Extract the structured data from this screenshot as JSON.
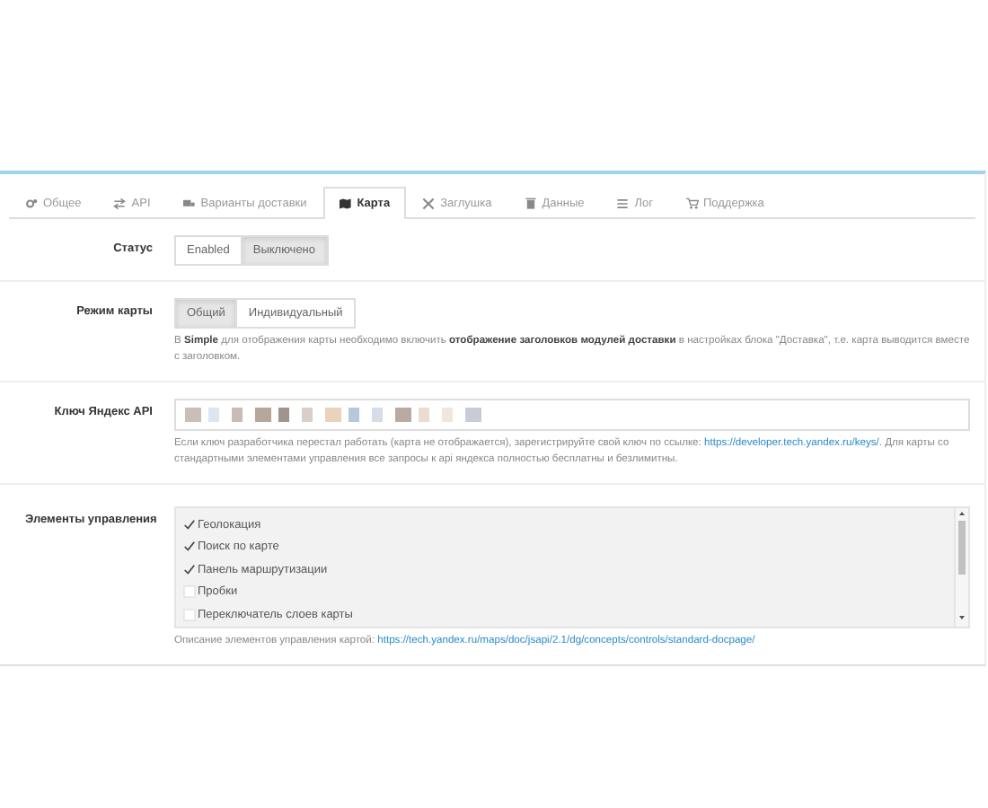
{
  "tabs": [
    {
      "label": "Общее",
      "selected": false
    },
    {
      "label": "API",
      "selected": false
    },
    {
      "label": "Варианты доставки",
      "selected": false
    },
    {
      "label": "Карта",
      "selected": true
    },
    {
      "label": "Заглушка",
      "selected": false
    },
    {
      "label": "Данные",
      "selected": false
    },
    {
      "label": "Лог",
      "selected": false
    },
    {
      "label": "Поддержка",
      "selected": false
    }
  ],
  "fields": [
    {
      "kind": "toggle",
      "label": "Статус",
      "options": [
        {
          "label": "Enabled",
          "selected": false
        },
        {
          "label": "Выключено",
          "selected": true
        }
      ]
    },
    {
      "kind": "toggle",
      "label": "Режим карты",
      "options": [
        {
          "label": "Общий",
          "selected": true
        },
        {
          "label": "Индивидуальный",
          "selected": false
        }
      ],
      "help": "В **Simple** для отображения карты необходимо включить **отображение заголовков модулей доставки** в настройках блока \"Доставка\", т.е. карта выводится вместе с заголовком."
    },
    {
      "kind": "key",
      "label": "Ключ Яндекс API",
      "help": "Если ключ разработчика перестал работать (карта не отображается), зарегистрируйте свой ключ по ссылке:",
      "help_link": "https://developer.tech.yandex.ru/keys/",
      "help_after": ". Для карты со стандартными элементами управления все запросы к api яндекса полностью бесплатны и безлимитны."
    },
    {
      "kind": "checklist",
      "label": "Элементы управления",
      "items": [
        {
          "label": "Геолокация",
          "checked": true
        },
        {
          "label": "Поиск по карте",
          "checked": true
        },
        {
          "label": "Панель маршрутизации",
          "checked": true
        },
        {
          "label": "Пробки",
          "checked": false
        },
        {
          "label": "Переключатель слоев карты",
          "checked": false
        }
      ],
      "help": "Описание элементов управления картой:",
      "help_link": "https://tech.yandex.ru/maps/doc/jsapi/2.1/dg/concepts/controls/standard-docpage/"
    }
  ]
}
